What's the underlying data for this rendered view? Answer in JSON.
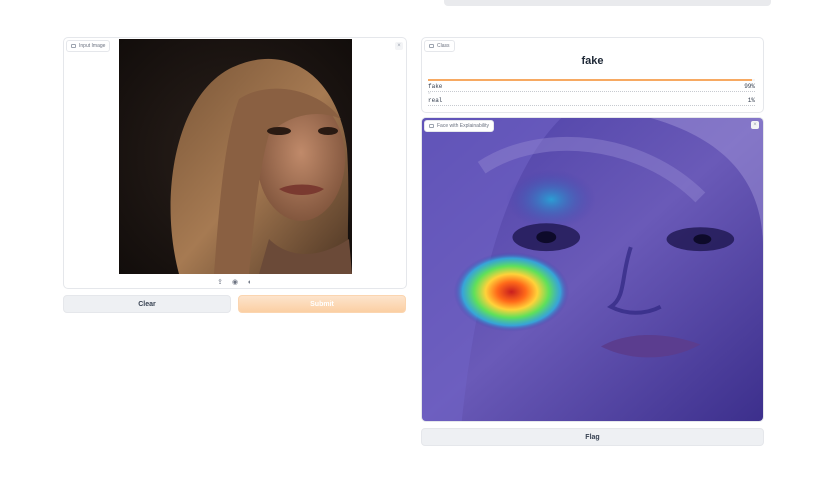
{
  "input_panel": {
    "tag_label": "Input Image",
    "close_glyph": "×",
    "toolbar_icons": [
      "upload-icon",
      "webcam-icon",
      "clipboard-icon"
    ],
    "toolbar_glyphs": [
      "⇪",
      "◉",
      "◐"
    ]
  },
  "buttons": {
    "clear": "Clear",
    "submit": "Submit",
    "flag": "Flag"
  },
  "class_panel": {
    "tag_label": "Class",
    "predicted_label": "fake",
    "confidences": [
      {
        "label": "fake",
        "value": "99%",
        "fraction": 0.99
      },
      {
        "label": "real",
        "value": "1%",
        "fraction": 0.01
      }
    ]
  },
  "explain_panel": {
    "tag_label": "Face with Explainability",
    "close_glyph": "×"
  },
  "colors": {
    "accent": "#f7a962",
    "submit_start": "#fde4cc",
    "submit_end": "#fbcfa3"
  }
}
